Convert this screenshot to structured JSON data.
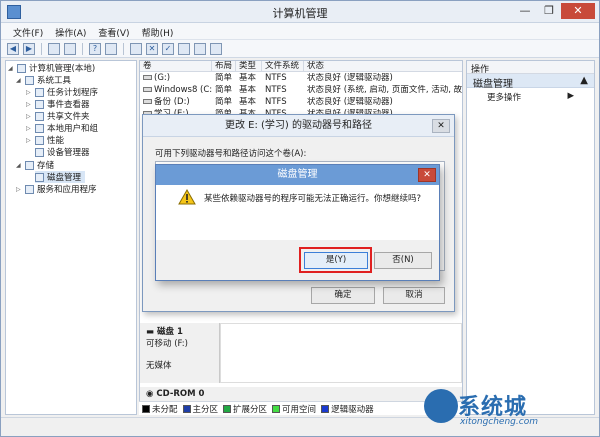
{
  "window": {
    "title": "计算机管理"
  },
  "window_controls": {
    "minimize": "—",
    "restore": "❐",
    "close": "✕"
  },
  "menu": [
    "文件(F)",
    "操作(A)",
    "查看(V)",
    "帮助(H)"
  ],
  "tree": [
    {
      "label": "计算机管理(本地)",
      "level": 0
    },
    {
      "label": "系统工具",
      "level": 1
    },
    {
      "label": "任务计划程序",
      "level": 2
    },
    {
      "label": "事件查看器",
      "level": 2
    },
    {
      "label": "共享文件夹",
      "level": 2
    },
    {
      "label": "本地用户和组",
      "level": 2
    },
    {
      "label": "性能",
      "level": 2
    },
    {
      "label": "设备管理器",
      "level": 2
    },
    {
      "label": "存储",
      "level": 1
    },
    {
      "label": "磁盘管理",
      "level": 2,
      "selected": true
    },
    {
      "label": "服务和应用程序",
      "level": 1
    }
  ],
  "volumes": {
    "headers": [
      "卷",
      "布局",
      "类型",
      "文件系统",
      "状态"
    ],
    "rows": [
      [
        "(G:)",
        "简单",
        "基本",
        "NTFS",
        "状态良好 (逻辑驱动器)"
      ],
      [
        "Windows8 (C:)",
        "简单",
        "基本",
        "NTFS",
        "状态良好 (系统, 启动, 页面文件, 活动, 故障"
      ],
      [
        "备份 (D:)",
        "简单",
        "基本",
        "NTFS",
        "状态良好 (逻辑驱动器)"
      ],
      [
        "学习 (E:)",
        "简单",
        "基本",
        "NTFS",
        "状态良好 (逻辑驱动器)"
      ]
    ]
  },
  "disk1": {
    "name": "磁盘 1",
    "type": "可移动 (F:)",
    "media": "无媒体"
  },
  "cdrom": {
    "name": "CD-ROM 0"
  },
  "legend": [
    {
      "label": "未分配",
      "color": "#000000"
    },
    {
      "label": "主分区",
      "color": "#1e3ea8"
    },
    {
      "label": "扩展分区",
      "color": "#22a844"
    },
    {
      "label": "可用空间",
      "color": "#44dd44"
    },
    {
      "label": "逻辑驱动器",
      "color": "#1a3ad0"
    }
  ],
  "actions": {
    "header": "操作",
    "section": "磁盘管理",
    "more": "更多操作"
  },
  "change_dialog": {
    "title": "更改 E: (学习) 的驱动器号和路径",
    "close": "✕",
    "prompt": "可用下列驱动器号和路径访问这个卷(A):",
    "ok": "确定",
    "cancel": "取消"
  },
  "confirm_dialog": {
    "title": "磁盘管理",
    "close": "✕",
    "message": "某些依赖驱动器号的程序可能无法正确运行。你想继续吗?",
    "yes": "是(Y)",
    "no": "否(N)"
  },
  "watermark": {
    "text": "系统城",
    "url": "xitongcheng.com"
  },
  "colors": {
    "accent": "#6b9bd6",
    "highlight": "#e02020",
    "selection": "#d8e6f6"
  }
}
